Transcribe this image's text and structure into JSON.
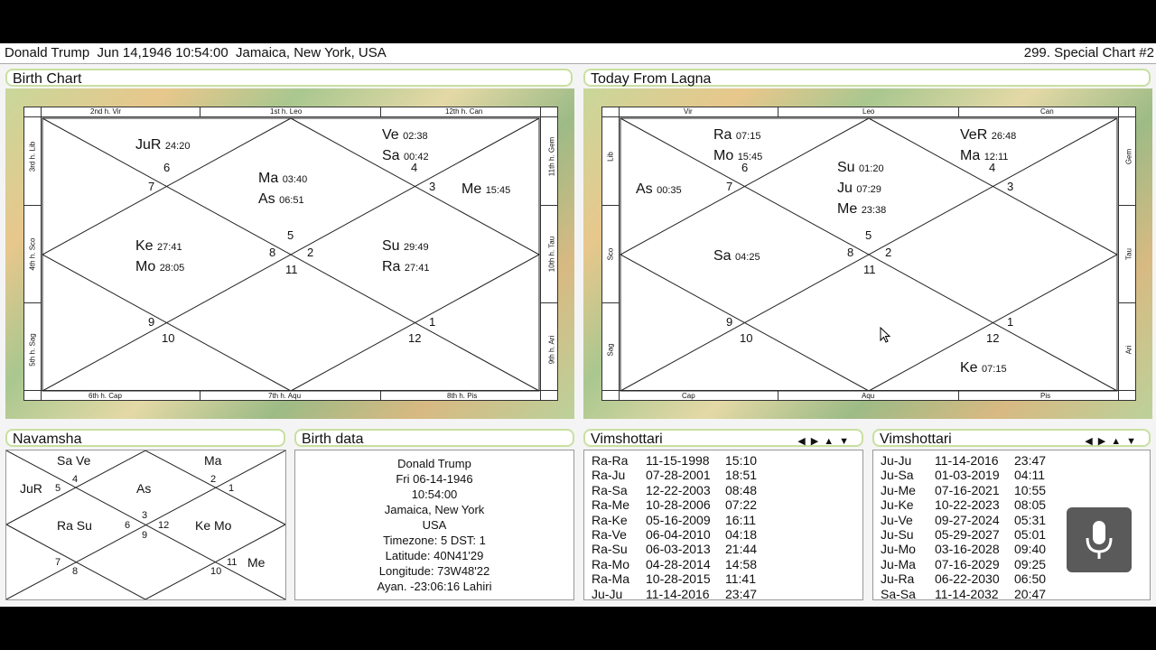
{
  "header": {
    "left": "Donald Trump  Jun 14,1946 10:54:00  Jamaica, New York, USA",
    "right": "299. Special Chart #2"
  },
  "birth_chart": {
    "title": "Birth Chart",
    "top": [
      "2nd h.  Vir",
      "1st h.  Leo",
      "12th h.  Can"
    ],
    "bottom": [
      "6th h.  Cap",
      "7th h.  Aqu",
      "8th h.  Pis"
    ],
    "left": [
      "3rd h.  Lib",
      "4th h.  Sco",
      "5th h.  Sag"
    ],
    "right": [
      "11th h.  Gem",
      "10th h.  Tau",
      "9th h.  Ari"
    ],
    "planets": [
      {
        "name": "JuR",
        "deg": "24:20"
      },
      {
        "name": "Ve",
        "deg": "02:38"
      },
      {
        "name": "Sa",
        "deg": "00:42"
      },
      {
        "name": "Ma",
        "deg": "03:40"
      },
      {
        "name": "As",
        "deg": "06:51"
      },
      {
        "name": "Me",
        "deg": "15:45"
      },
      {
        "name": "Ke",
        "deg": "27:41"
      },
      {
        "name": "Mo",
        "deg": "28:05"
      },
      {
        "name": "Su",
        "deg": "29:49"
      },
      {
        "name": "Ra",
        "deg": "27:41"
      }
    ],
    "numbers": [
      "6",
      "7",
      "4",
      "3",
      "5",
      "8",
      "2",
      "11",
      "9",
      "10",
      "1",
      "12"
    ]
  },
  "today_chart": {
    "title": "Today From Lagna",
    "top": [
      "Vir",
      "Leo",
      "Can"
    ],
    "bottom": [
      "Cap",
      "Aqu",
      "Pis"
    ],
    "left": [
      "Lib",
      "Sco",
      "Sag"
    ],
    "right": [
      "Gem",
      "Tau",
      "Ari"
    ],
    "planets": [
      {
        "name": "Ra",
        "deg": "07:15"
      },
      {
        "name": "Mo",
        "deg": "15:45"
      },
      {
        "name": "VeR",
        "deg": "26:48"
      },
      {
        "name": "Ma",
        "deg": "12:11"
      },
      {
        "name": "As",
        "deg": "00:35"
      },
      {
        "name": "Su",
        "deg": "01:20"
      },
      {
        "name": "Ju",
        "deg": "07:29"
      },
      {
        "name": "Me",
        "deg": "23:38"
      },
      {
        "name": "Sa",
        "deg": "04:25"
      },
      {
        "name": "Ke",
        "deg": "07:15"
      }
    ],
    "numbers": [
      "6",
      "7",
      "4",
      "3",
      "5",
      "8",
      "2",
      "11",
      "9",
      "10",
      "1",
      "12"
    ]
  },
  "navamsha": {
    "title": "Navamsha",
    "labels": [
      "Sa Ve",
      "Ma",
      "JuR",
      "As",
      "Ra Su",
      "Ke Mo",
      "Me"
    ],
    "numbers": [
      "4",
      "2",
      "5",
      "1",
      "3",
      "6",
      "12",
      "9",
      "7",
      "8",
      "10",
      "11"
    ]
  },
  "birth_data": {
    "title": "Birth data",
    "lines": [
      "Donald Trump",
      "Fri 06-14-1946",
      "10:54:00",
      "Jamaica, New York",
      "USA",
      "Timezone: 5 DST: 1",
      "Latitude: 40N41'29",
      "Longitude: 73W48'22",
      "Ayan. -23:06:16 Lahiri"
    ]
  },
  "vim1": {
    "title": "Vimshottari",
    "rows": [
      [
        "Ra-Ra",
        "11-15-1998",
        "15:10"
      ],
      [
        "Ra-Ju",
        "07-28-2001",
        "18:51"
      ],
      [
        "Ra-Sa",
        "12-22-2003",
        "08:48"
      ],
      [
        "Ra-Me",
        "10-28-2006",
        "07:22"
      ],
      [
        "Ra-Ke",
        "05-16-2009",
        "16:11"
      ],
      [
        "Ra-Ve",
        "06-04-2010",
        "04:18"
      ],
      [
        "Ra-Su",
        "06-03-2013",
        "21:44"
      ],
      [
        "Ra-Mo",
        "04-28-2014",
        "14:58"
      ],
      [
        "Ra-Ma",
        "10-28-2015",
        "11:41"
      ],
      [
        "Ju-Ju",
        "11-14-2016",
        "23:47"
      ]
    ]
  },
  "vim2": {
    "title": "Vimshottari",
    "rows": [
      [
        "Ju-Ju",
        "11-14-2016",
        "23:47"
      ],
      [
        "Ju-Sa",
        "01-03-2019",
        "04:11"
      ],
      [
        "Ju-Me",
        "07-16-2021",
        "10:55"
      ],
      [
        "Ju-Ke",
        "10-22-2023",
        "08:05"
      ],
      [
        "Ju-Ve",
        "09-27-2024",
        "05:31"
      ],
      [
        "Ju-Su",
        "05-29-2027",
        "05:01"
      ],
      [
        "Ju-Mo",
        "03-16-2028",
        "09:40"
      ],
      [
        "Ju-Ma",
        "07-16-2029",
        "09:25"
      ],
      [
        "Ju-Ra",
        "06-22-2030",
        "06:50"
      ],
      [
        "Sa-Sa",
        "11-14-2032",
        "20:47"
      ]
    ]
  }
}
